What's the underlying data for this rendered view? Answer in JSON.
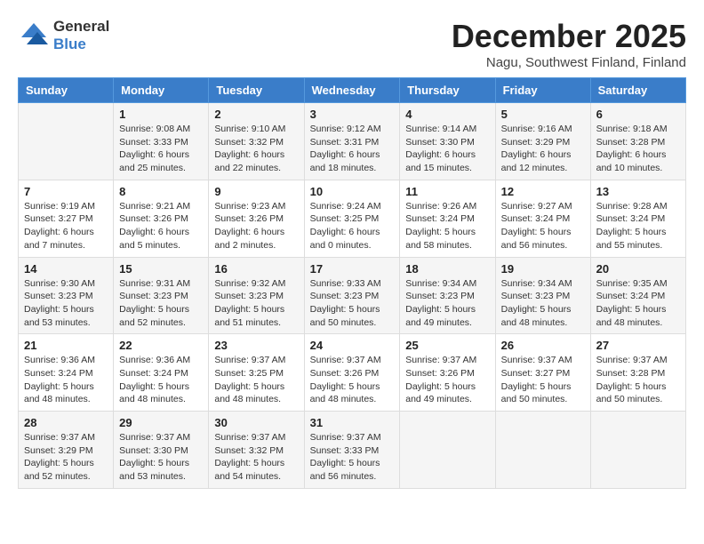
{
  "logo": {
    "line1": "General",
    "line2": "Blue"
  },
  "title": "December 2025",
  "location": "Nagu, Southwest Finland, Finland",
  "weekdays": [
    "Sunday",
    "Monday",
    "Tuesday",
    "Wednesday",
    "Thursday",
    "Friday",
    "Saturday"
  ],
  "weeks": [
    [
      {
        "day": "",
        "sunrise": "",
        "sunset": "",
        "daylight": ""
      },
      {
        "day": "1",
        "sunrise": "Sunrise: 9:08 AM",
        "sunset": "Sunset: 3:33 PM",
        "daylight": "Daylight: 6 hours and 25 minutes."
      },
      {
        "day": "2",
        "sunrise": "Sunrise: 9:10 AM",
        "sunset": "Sunset: 3:32 PM",
        "daylight": "Daylight: 6 hours and 22 minutes."
      },
      {
        "day": "3",
        "sunrise": "Sunrise: 9:12 AM",
        "sunset": "Sunset: 3:31 PM",
        "daylight": "Daylight: 6 hours and 18 minutes."
      },
      {
        "day": "4",
        "sunrise": "Sunrise: 9:14 AM",
        "sunset": "Sunset: 3:30 PM",
        "daylight": "Daylight: 6 hours and 15 minutes."
      },
      {
        "day": "5",
        "sunrise": "Sunrise: 9:16 AM",
        "sunset": "Sunset: 3:29 PM",
        "daylight": "Daylight: 6 hours and 12 minutes."
      },
      {
        "day": "6",
        "sunrise": "Sunrise: 9:18 AM",
        "sunset": "Sunset: 3:28 PM",
        "daylight": "Daylight: 6 hours and 10 minutes."
      }
    ],
    [
      {
        "day": "7",
        "sunrise": "Sunrise: 9:19 AM",
        "sunset": "Sunset: 3:27 PM",
        "daylight": "Daylight: 6 hours and 7 minutes."
      },
      {
        "day": "8",
        "sunrise": "Sunrise: 9:21 AM",
        "sunset": "Sunset: 3:26 PM",
        "daylight": "Daylight: 6 hours and 5 minutes."
      },
      {
        "day": "9",
        "sunrise": "Sunrise: 9:23 AM",
        "sunset": "Sunset: 3:26 PM",
        "daylight": "Daylight: 6 hours and 2 minutes."
      },
      {
        "day": "10",
        "sunrise": "Sunrise: 9:24 AM",
        "sunset": "Sunset: 3:25 PM",
        "daylight": "Daylight: 6 hours and 0 minutes."
      },
      {
        "day": "11",
        "sunrise": "Sunrise: 9:26 AM",
        "sunset": "Sunset: 3:24 PM",
        "daylight": "Daylight: 5 hours and 58 minutes."
      },
      {
        "day": "12",
        "sunrise": "Sunrise: 9:27 AM",
        "sunset": "Sunset: 3:24 PM",
        "daylight": "Daylight: 5 hours and 56 minutes."
      },
      {
        "day": "13",
        "sunrise": "Sunrise: 9:28 AM",
        "sunset": "Sunset: 3:24 PM",
        "daylight": "Daylight: 5 hours and 55 minutes."
      }
    ],
    [
      {
        "day": "14",
        "sunrise": "Sunrise: 9:30 AM",
        "sunset": "Sunset: 3:23 PM",
        "daylight": "Daylight: 5 hours and 53 minutes."
      },
      {
        "day": "15",
        "sunrise": "Sunrise: 9:31 AM",
        "sunset": "Sunset: 3:23 PM",
        "daylight": "Daylight: 5 hours and 52 minutes."
      },
      {
        "day": "16",
        "sunrise": "Sunrise: 9:32 AM",
        "sunset": "Sunset: 3:23 PM",
        "daylight": "Daylight: 5 hours and 51 minutes."
      },
      {
        "day": "17",
        "sunrise": "Sunrise: 9:33 AM",
        "sunset": "Sunset: 3:23 PM",
        "daylight": "Daylight: 5 hours and 50 minutes."
      },
      {
        "day": "18",
        "sunrise": "Sunrise: 9:34 AM",
        "sunset": "Sunset: 3:23 PM",
        "daylight": "Daylight: 5 hours and 49 minutes."
      },
      {
        "day": "19",
        "sunrise": "Sunrise: 9:34 AM",
        "sunset": "Sunset: 3:23 PM",
        "daylight": "Daylight: 5 hours and 48 minutes."
      },
      {
        "day": "20",
        "sunrise": "Sunrise: 9:35 AM",
        "sunset": "Sunset: 3:24 PM",
        "daylight": "Daylight: 5 hours and 48 minutes."
      }
    ],
    [
      {
        "day": "21",
        "sunrise": "Sunrise: 9:36 AM",
        "sunset": "Sunset: 3:24 PM",
        "daylight": "Daylight: 5 hours and 48 minutes."
      },
      {
        "day": "22",
        "sunrise": "Sunrise: 9:36 AM",
        "sunset": "Sunset: 3:24 PM",
        "daylight": "Daylight: 5 hours and 48 minutes."
      },
      {
        "day": "23",
        "sunrise": "Sunrise: 9:37 AM",
        "sunset": "Sunset: 3:25 PM",
        "daylight": "Daylight: 5 hours and 48 minutes."
      },
      {
        "day": "24",
        "sunrise": "Sunrise: 9:37 AM",
        "sunset": "Sunset: 3:26 PM",
        "daylight": "Daylight: 5 hours and 48 minutes."
      },
      {
        "day": "25",
        "sunrise": "Sunrise: 9:37 AM",
        "sunset": "Sunset: 3:26 PM",
        "daylight": "Daylight: 5 hours and 49 minutes."
      },
      {
        "day": "26",
        "sunrise": "Sunrise: 9:37 AM",
        "sunset": "Sunset: 3:27 PM",
        "daylight": "Daylight: 5 hours and 50 minutes."
      },
      {
        "day": "27",
        "sunrise": "Sunrise: 9:37 AM",
        "sunset": "Sunset: 3:28 PM",
        "daylight": "Daylight: 5 hours and 50 minutes."
      }
    ],
    [
      {
        "day": "28",
        "sunrise": "Sunrise: 9:37 AM",
        "sunset": "Sunset: 3:29 PM",
        "daylight": "Daylight: 5 hours and 52 minutes."
      },
      {
        "day": "29",
        "sunrise": "Sunrise: 9:37 AM",
        "sunset": "Sunset: 3:30 PM",
        "daylight": "Daylight: 5 hours and 53 minutes."
      },
      {
        "day": "30",
        "sunrise": "Sunrise: 9:37 AM",
        "sunset": "Sunset: 3:32 PM",
        "daylight": "Daylight: 5 hours and 54 minutes."
      },
      {
        "day": "31",
        "sunrise": "Sunrise: 9:37 AM",
        "sunset": "Sunset: 3:33 PM",
        "daylight": "Daylight: 5 hours and 56 minutes."
      },
      {
        "day": "",
        "sunrise": "",
        "sunset": "",
        "daylight": ""
      },
      {
        "day": "",
        "sunrise": "",
        "sunset": "",
        "daylight": ""
      },
      {
        "day": "",
        "sunrise": "",
        "sunset": "",
        "daylight": ""
      }
    ]
  ]
}
